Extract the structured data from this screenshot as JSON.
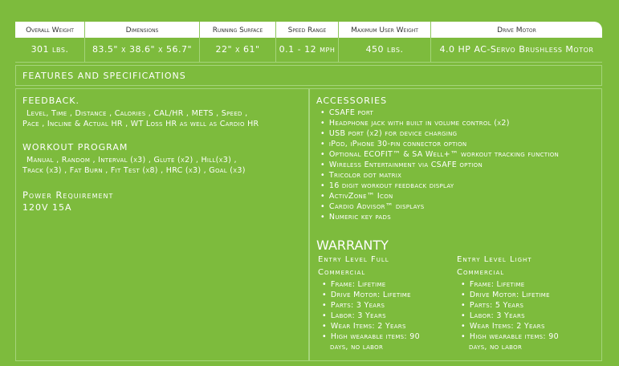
{
  "specs": {
    "headers": [
      "Overall Weight",
      "Dimensions",
      "Running Surface",
      "Speed Range",
      "Maximum User Weight",
      "Drive Motor"
    ],
    "values": [
      "301 lbs.",
      "83.5\" x 38.6\" x 56.7\"",
      "22\" x 61\"",
      "0.1 - 12 mph",
      "450 lbs.",
      "4.0 HP AC-Servo Brushless Motor"
    ]
  },
  "features_title": "FEATURES AND SPECIFICATIONS",
  "feedback": {
    "title": "FEEDBACK.",
    "line1": "Level, Time , Distance , Calories , CAL/HR , METS , Speed ,",
    "line2": "Pace , Incline & Actual HR , WT Loss HR as well as Cardio HR"
  },
  "workout": {
    "title": "WORKOUT PROGRAM",
    "line1": "Manual , Random , Interval (x3) , Glute (x2) , Hill(x3) ,",
    "line2": "Track (x3) , Fat Burn , Fit Test (x8) , HRC (x3) , Goal (x3)"
  },
  "power": {
    "title": "Power Requirement",
    "value": "120V 15A"
  },
  "accessories": {
    "title": "ACCESSORIES",
    "items": [
      "CSAFE port",
      "Headphone jack with built in volume control (x2)",
      "USB port (x2) for device charging",
      "iPod, iPhone 30-pin connector option",
      "Optional ECOFIT™ & SA Well+™ workout tracking function",
      "Wireless Entertainment via CSAFE option",
      "Tricolor dot matrix",
      "16 digit workout feedback display",
      "ActivZone™ Icon",
      "Cardio Advisor™ displays",
      "Numeric key pads"
    ]
  },
  "warranty": {
    "title": "WARRANTY",
    "full": {
      "title1": "Entry Level Full",
      "title2": "Commercial",
      "items": [
        "Frame:   Lifetime",
        "Drive Motor: Lifetime",
        "Parts:   3 Years",
        "Labor:   3 Years",
        "Wear Items:   2 Years",
        "High wearable items: 90"
      ],
      "cont": "days, no labor"
    },
    "light": {
      "title1": "Entry Level Light",
      "title2": "Commercial",
      "items": [
        "Frame:   Lifetime",
        "Drive Motor: Lifetime",
        "Parts:   5 Years",
        "Labor:   3 Years",
        "Wear Items:   2 Years",
        "High wearable items: 90"
      ],
      "cont": "days, no labor"
    }
  },
  "colors": {
    "background": "#7dbb3d",
    "header_bg": "#ffffff",
    "header_text": "#333333",
    "border": "#a5d47a"
  }
}
